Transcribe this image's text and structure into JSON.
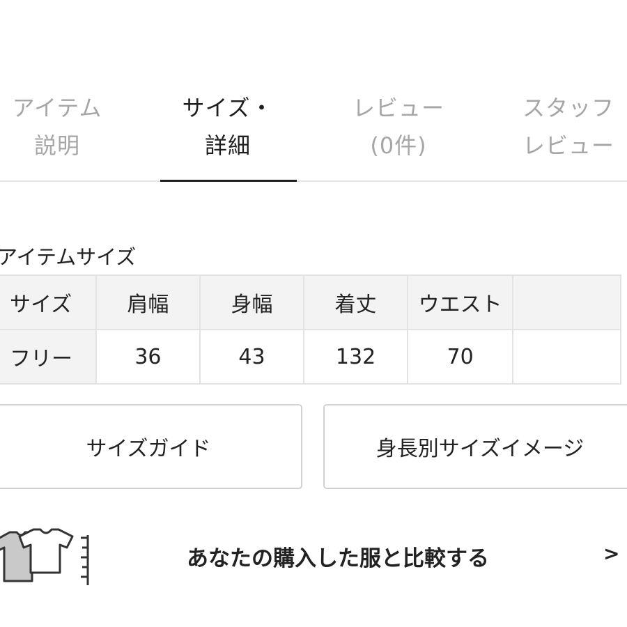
{
  "tabs": [
    {
      "line1": "アイテム",
      "line2": "説明",
      "active": false
    },
    {
      "line1": "サイズ・",
      "line2": "詳細",
      "active": true
    },
    {
      "line1": "レビュー",
      "line2": "(0件)",
      "active": false
    },
    {
      "line1": "スタッフ",
      "line2": "レビュー",
      "active": false
    }
  ],
  "size_section": {
    "title": "アイテムサイズ",
    "headers": [
      "サイズ",
      "肩幅",
      "身幅",
      "着丈",
      "ウエスト",
      ""
    ],
    "row": [
      "フリー",
      "36",
      "43",
      "132",
      "70",
      ""
    ]
  },
  "buttons": {
    "size_guide": "サイズガイド",
    "height_image": "身長別サイズイメージ"
  },
  "compare": {
    "text": "あなたの購入した服と比較する",
    "arrow": ">",
    "icon": "tshirt-compare-icon"
  },
  "colors": {
    "active_text": "#1e1e1e",
    "inactive_text": "#a6a6a6",
    "table_border": "#e3e3e3",
    "header_bg": "#f3f3f3",
    "shirt_back": "#c9c9c9"
  }
}
